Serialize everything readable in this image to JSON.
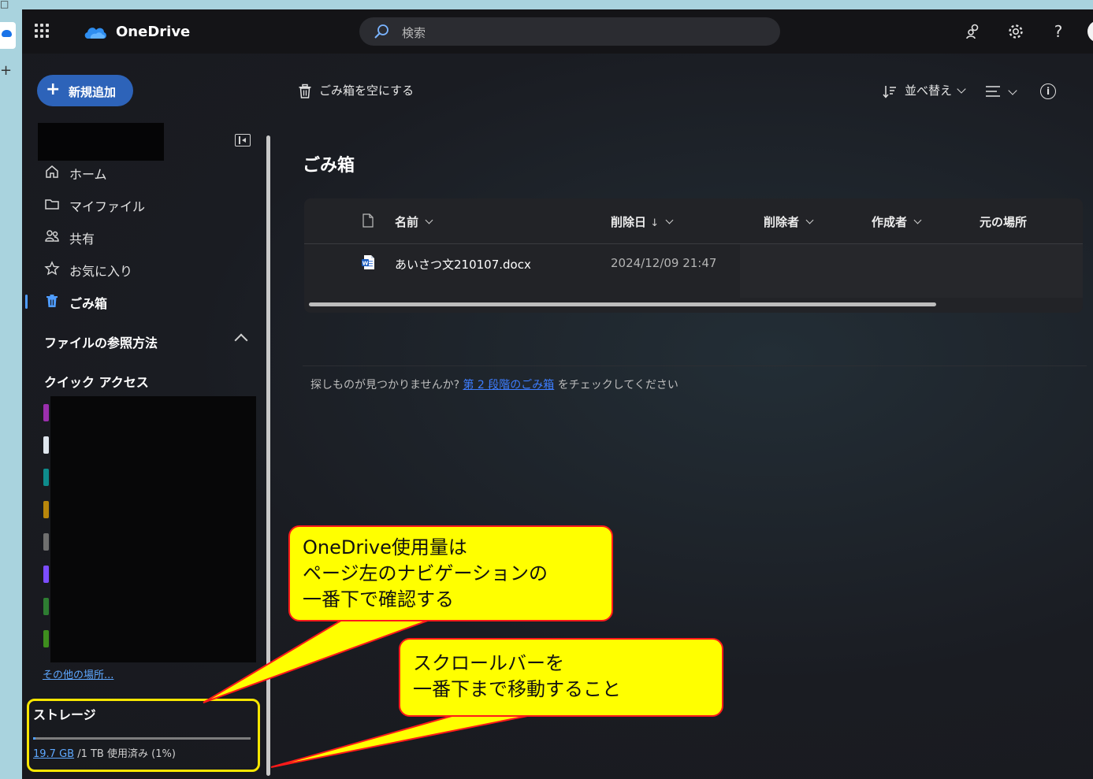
{
  "header": {
    "brand": "OneDrive",
    "search_placeholder": "検索"
  },
  "sidebar": {
    "new_button_label": "新規追加",
    "nav": [
      {
        "label": "ホーム",
        "icon": "home-icon"
      },
      {
        "label": "マイファイル",
        "icon": "folder-icon"
      },
      {
        "label": "共有",
        "icon": "people-icon"
      },
      {
        "label": "お気に入り",
        "icon": "star-icon"
      },
      {
        "label": "ごみ箱",
        "icon": "trash-icon",
        "active": true
      }
    ],
    "browse_heading": "ファイルの参照方法",
    "quick_access_heading": "クイック アクセス",
    "quick_access_colors": [
      "#9b2fae",
      "#dfe6ee",
      "#0e8c8c",
      "#b8860b",
      "#6f6f6f",
      "#7c4dff",
      "#2e7d32",
      "#3e8e1e"
    ],
    "more_places_link": "その他の場所...",
    "storage": {
      "title": "ストレージ",
      "used": "19.7 GB",
      "rest": " /1 TB 使用済み (1%)",
      "percent": 1
    }
  },
  "commandbar": {
    "empty_bin_label": "ごみ箱を空にする",
    "sort_label": "並べ替え"
  },
  "main": {
    "title": "ごみ箱",
    "columns": {
      "name": "名前",
      "deleted_date": "削除日",
      "deleted_date_sort": "↓",
      "deleted_by": "削除者",
      "created_by": "作成者",
      "original_location": "元の場所"
    },
    "rows": [
      {
        "name": "あいさつ文210107.docx",
        "deleted_date": "2024/12/09 21:47"
      }
    ],
    "hint": {
      "before": "探しものが見つかりませんか? ",
      "link": "第 2 段階のごみ箱",
      "after": " をチェックしてください"
    }
  },
  "annotations": {
    "callout1_lines": [
      "OneDrive使用量は",
      "ページ左のナビゲーションの",
      "一番下で確認する"
    ],
    "callout2_lines": [
      "スクロールバーを",
      "一番下まで移動すること"
    ],
    "highlight_color": "#f7e600",
    "callout_fill": "#ffff00",
    "callout_border": "#ff1a1a"
  }
}
